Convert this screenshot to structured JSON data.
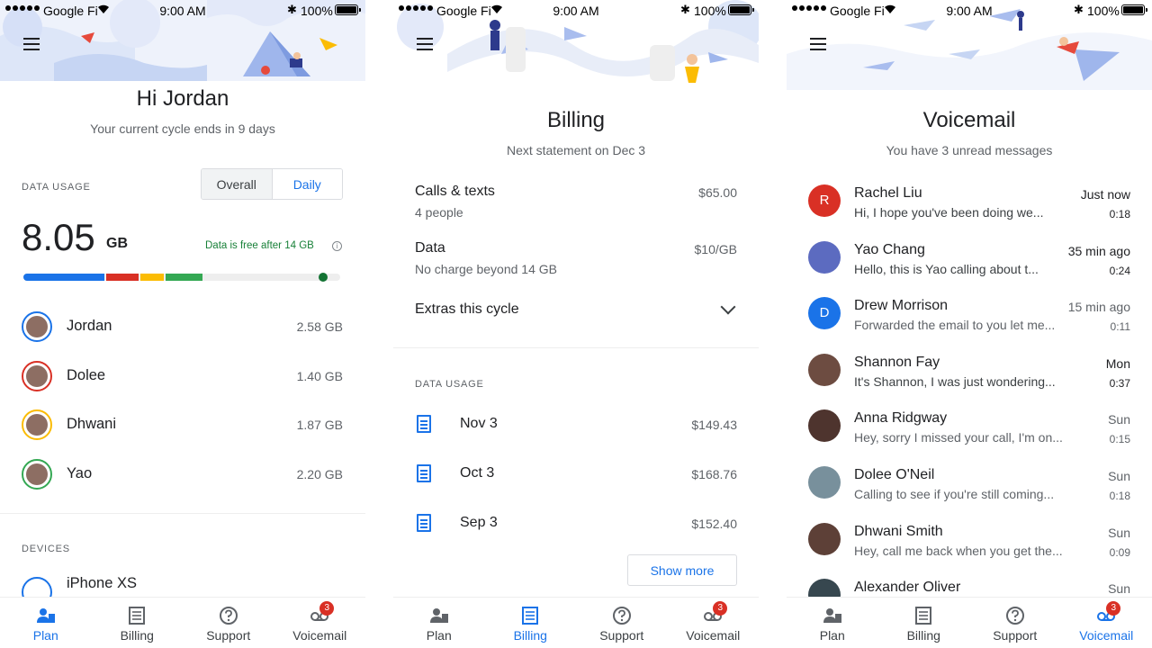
{
  "status": {
    "carrier": "Google Fi",
    "time": "9:00 AM",
    "battery": "100%"
  },
  "plan": {
    "title": "Hi Jordan",
    "subtitle": "Your current cycle ends in 9 days",
    "data_usage_label": "DATA USAGE",
    "toggle": {
      "overall": "Overall",
      "daily": "Daily",
      "selected": "Daily"
    },
    "usage_value": "8.05",
    "usage_unit": "GB",
    "free_note": "Data is free after 14 GB",
    "usage_bar": [
      {
        "color": "#1a73e8",
        "fraction": 0.26
      },
      {
        "color": "#d93025",
        "fraction": 0.11
      },
      {
        "color": "#fbbc04",
        "fraction": 0.08
      },
      {
        "color": "#34a853",
        "fraction": 0.12
      }
    ],
    "members": [
      {
        "name": "Jordan",
        "amount": "2.58 GB",
        "ring": "#1a73e8"
      },
      {
        "name": "Dolee",
        "amount": "1.40 GB",
        "ring": "#d93025"
      },
      {
        "name": "Dhwani",
        "amount": "1.87 GB",
        "ring": "#fbbc04"
      },
      {
        "name": "Yao",
        "amount": "2.20 GB",
        "ring": "#34a853"
      }
    ],
    "devices_label": "DEVICES",
    "device": "iPhone XS"
  },
  "billing": {
    "title": "Billing",
    "subtitle": "Next statement on Dec 3",
    "rows": [
      {
        "label": "Calls & texts",
        "sub": "4 people",
        "value": "$65.00"
      },
      {
        "label": "Data",
        "sub": "No charge beyond 14 GB",
        "value": "$10/GB"
      }
    ],
    "extras": "Extras this cycle",
    "data_usage_label": "DATA USAGE",
    "statements": [
      {
        "date": "Nov 3",
        "amount": "$149.43"
      },
      {
        "date": "Oct 3",
        "amount": "$168.76"
      },
      {
        "date": "Sep 3",
        "amount": "$152.40"
      }
    ],
    "show_more": "Show more"
  },
  "voicemail": {
    "title": "Voicemail",
    "subtitle": "You have 3 unread messages",
    "messages": [
      {
        "name": "Rachel Liu",
        "preview": "Hi, I hope you've been doing we...",
        "time": "Just now",
        "duration": "0:18",
        "initial": "R",
        "color": "#d93025",
        "unread": true
      },
      {
        "name": "Yao Chang",
        "preview": "Hello, this is Yao calling about t...",
        "time": "35 min ago",
        "duration": "0:24",
        "initial": "",
        "color": "#5c6bc0",
        "unread": true
      },
      {
        "name": "Drew Morrison",
        "preview": "Forwarded the email to you let me...",
        "time": "15 min ago",
        "duration": "0:11",
        "initial": "D",
        "color": "#1a73e8",
        "unread": false
      },
      {
        "name": "Shannon Fay",
        "preview": "It's Shannon, I was just wondering...",
        "time": "Mon",
        "duration": "0:37",
        "initial": "",
        "color": "#6d4c41",
        "unread": true
      },
      {
        "name": "Anna Ridgway",
        "preview": "Hey, sorry I missed your call, I'm on...",
        "time": "Sun",
        "duration": "0:15",
        "initial": "",
        "color": "#4e342e",
        "unread": false
      },
      {
        "name": "Dolee O'Neil",
        "preview": "Calling to see if you're still coming...",
        "time": "Sun",
        "duration": "0:18",
        "initial": "",
        "color": "#78909c",
        "unread": false
      },
      {
        "name": "Dhwani Smith",
        "preview": "Hey, call me back when you get the...",
        "time": "Sun",
        "duration": "0:09",
        "initial": "",
        "color": "#5d4037",
        "unread": false
      },
      {
        "name": "Alexander Oliver",
        "preview": "",
        "time": "Sun",
        "duration": "",
        "initial": "",
        "color": "#37474f",
        "unread": false
      }
    ]
  },
  "nav": {
    "items": [
      {
        "label": "Plan",
        "icon": "plan-icon"
      },
      {
        "label": "Billing",
        "icon": "billing-icon"
      },
      {
        "label": "Support",
        "icon": "support-icon"
      },
      {
        "label": "Voicemail",
        "icon": "voicemail-icon"
      }
    ],
    "badge": "3",
    "active_color": "#1a73e8"
  }
}
